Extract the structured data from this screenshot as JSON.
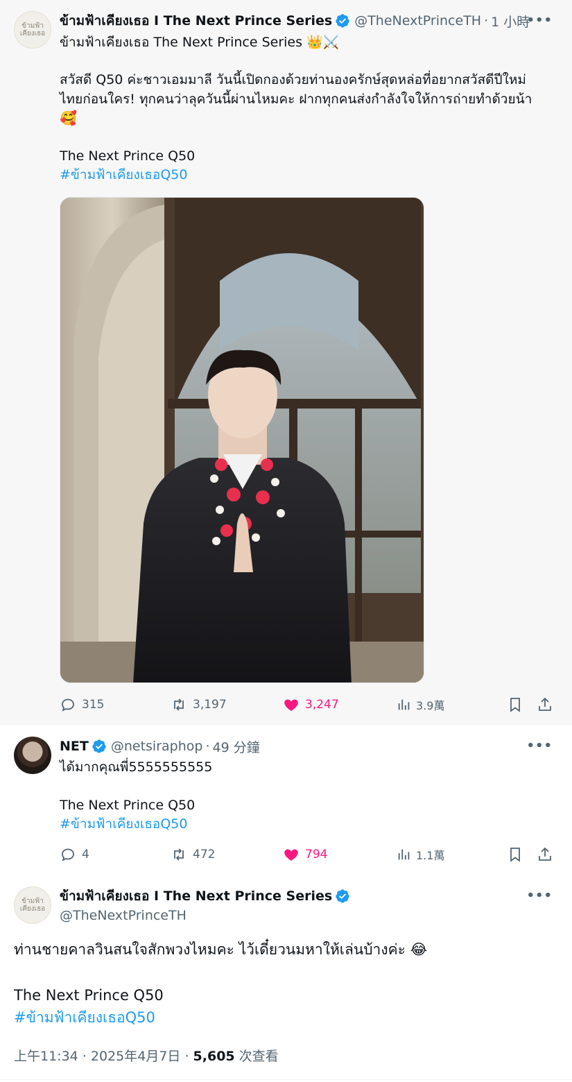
{
  "tweet1": {
    "name": "ข้ามฟ้าเคียงเธอ I The Next Prince Series",
    "handle": "@TheNextPrinceTH",
    "time": "1 小時",
    "avatar_lines": [
      "ข้ามฟ้า",
      "เคียงเธอ"
    ],
    "line1": "ข้ามฟ้าเคียงเธอ The Next Prince Series 👑⚔️",
    "line2": "สวัสดี Q50 ค่ะชาวเอมมาลี วันนี้เปิดกองด้วยท่านองครักษ์สุดหล่อที่อยากสวัสดีปีใหม่",
    "line3": "ไทยก่อนใคร! ทุกคนว่าลุควันนี้ผ่านไหมคะ ฝากทุกคนส่งกำลังใจให้การถ่ายทำด้วยน้า",
    "line4": "🥰",
    "line5": "The Next Prince Q50",
    "hashtag": "#ข้ามฟ้าเคียงเธอQ50",
    "replies": "315",
    "retweets": "3,197",
    "likes": "3,247",
    "views": "3.9萬"
  },
  "tweet2": {
    "name": "NET",
    "handle": "@netsiraphop",
    "time": "49 分鐘",
    "line1": "ได้มากคุณพี่5555555555",
    "line2": "The Next Prince Q50",
    "hashtag": "#ข้ามฟ้าเคียงเธอQ50",
    "replies": "4",
    "retweets": "472",
    "likes": "794",
    "views": "1.1萬"
  },
  "tweet3": {
    "name": "ข้ามฟ้าเคียงเธอ I The Next Prince Series",
    "handle": "@TheNextPrinceTH",
    "line1": "ท่านชายคาลวินสนใจสักพวงไหมคะ ไว้เดี๋ยวนมหาให้เล่นบ้างค่ะ 😂",
    "line2": "The Next Prince Q50",
    "hashtag": "#ข้ามฟ้าเคียงเธอQ50",
    "time_label": "上午11:34 · 2025年4月7日 · ",
    "view_count": "5,605",
    "view_suffix": " 次查看"
  },
  "more_label": "•••",
  "dot": "·",
  "colors": {
    "accent": "#1d9bf0",
    "like": "#f91880",
    "secondary": "#536471",
    "text": "#0f1419",
    "focused_bg": "#f7f7f7"
  },
  "icons": [
    "verified-badge-icon",
    "reply-icon",
    "retweet-icon",
    "heart-icon",
    "views-icon",
    "bookmark-icon",
    "share-icon",
    "more-icon"
  ]
}
